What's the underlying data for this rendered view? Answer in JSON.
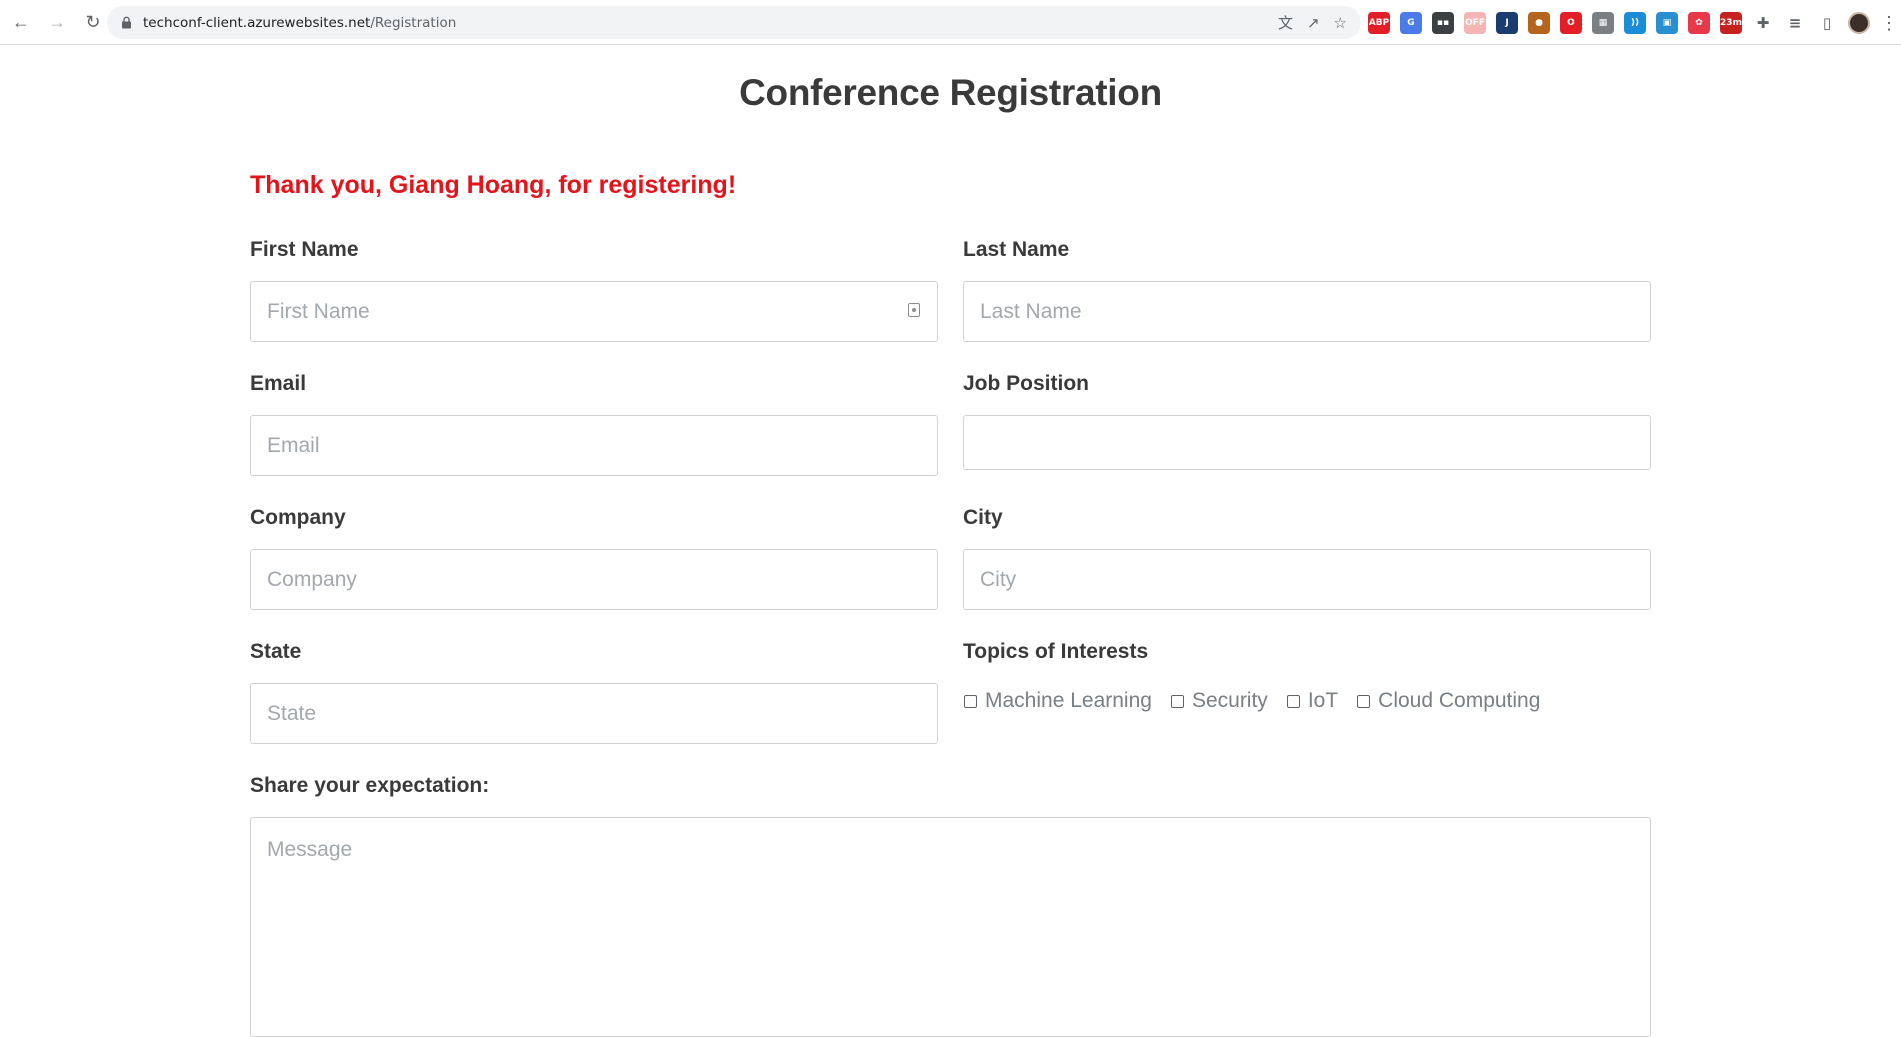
{
  "browser": {
    "url_host": "techconf-client.azurewebsites.net",
    "url_path": "/Registration",
    "extensions": [
      {
        "name": "adblock-plus-extension-icon",
        "label": "ABP",
        "color": "#e41e26"
      },
      {
        "name": "google-translate-extension-icon",
        "label": "G",
        "color": "#4a7be6"
      },
      {
        "name": "dark-extension-icon",
        "label": "▪▪",
        "color": "#3c4043"
      },
      {
        "name": "red-badge-extension-icon",
        "label": "OFF",
        "color": "#f5b5b5"
      },
      {
        "name": "j-extension-icon",
        "label": "J",
        "color": "#1a3c6e"
      },
      {
        "name": "cookie-extension-icon",
        "label": "●",
        "color": "#b5651d"
      },
      {
        "name": "opera-extension-icon",
        "label": "O",
        "color": "#e41e26"
      },
      {
        "name": "qr-extension-icon",
        "label": "▦",
        "color": "#7a7f84"
      },
      {
        "name": "wifi-extension-icon",
        "label": "))",
        "color": "#1a8cd8"
      },
      {
        "name": "window-extension-icon",
        "label": "▣",
        "color": "#2a8fd0"
      },
      {
        "name": "red-square-extension-icon",
        "label": "✿",
        "color": "#e8394a"
      },
      {
        "name": "timer-extension-icon",
        "label": "23m",
        "color": "#c5221f"
      }
    ]
  },
  "page": {
    "title": "Conference Registration",
    "thanks_message": "Thank you, Giang Hoang, for registering!",
    "fields": {
      "first_name": {
        "label": "First Name",
        "placeholder": "First Name",
        "value": ""
      },
      "last_name": {
        "label": "Last Name",
        "placeholder": "Last Name",
        "value": ""
      },
      "email": {
        "label": "Email",
        "placeholder": "Email",
        "value": ""
      },
      "job_position": {
        "label": "Job Position",
        "placeholder": "",
        "value": ""
      },
      "company": {
        "label": "Company",
        "placeholder": "Company",
        "value": ""
      },
      "city": {
        "label": "City",
        "placeholder": "City",
        "value": ""
      },
      "state": {
        "label": "State",
        "placeholder": "State",
        "value": ""
      }
    },
    "topics": {
      "label": "Topics of Interests",
      "options": [
        "Machine Learning",
        "Security",
        "IoT",
        "Cloud Computing"
      ]
    },
    "expectation": {
      "label": "Share your expectation:",
      "placeholder": "Message"
    }
  },
  "colors": {
    "thanks_red": "#e4141b",
    "text_dark": "#3a3a3a",
    "placeholder": "#a3a8ad",
    "border": "#cfd3d7"
  }
}
